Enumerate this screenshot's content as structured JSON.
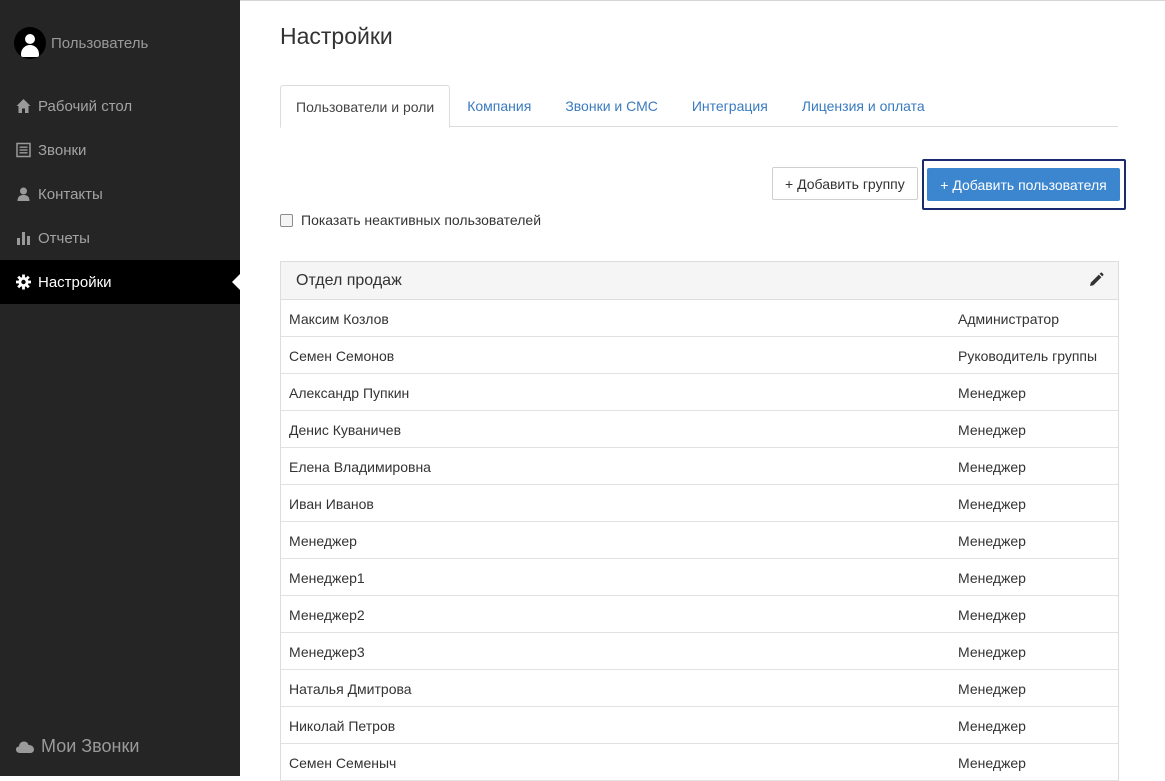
{
  "sidebar": {
    "user_label": "Пользователь",
    "items": [
      {
        "label": "Рабочий стол",
        "icon": "home-icon",
        "active": false
      },
      {
        "label": "Звонки",
        "icon": "list-icon",
        "active": false
      },
      {
        "label": "Контакты",
        "icon": "person-icon",
        "active": false
      },
      {
        "label": "Отчеты",
        "icon": "bar-chart-icon",
        "active": false
      },
      {
        "label": "Настройки",
        "icon": "gear-icon",
        "active": true
      }
    ],
    "brand": "Мои Звонки"
  },
  "main": {
    "title": "Настройки",
    "tabs": [
      {
        "label": "Пользователи и роли",
        "active": true
      },
      {
        "label": "Компания",
        "active": false
      },
      {
        "label": "Звонки и СМС",
        "active": false
      },
      {
        "label": "Интеграция",
        "active": false
      },
      {
        "label": "Лицензия и оплата",
        "active": false
      }
    ],
    "add_group_label": "+ Добавить группу",
    "add_user_label": "+ Добавить пользователя",
    "show_inactive_label": "Показать неактивных пользователей",
    "show_inactive_checked": false,
    "group": {
      "name": "Отдел продаж",
      "users": [
        {
          "name": "Максим Козлов",
          "role": "Администратор"
        },
        {
          "name": "Семен Семонов",
          "role": "Руководитель группы"
        },
        {
          "name": "Александр Пупкин",
          "role": "Менеджер"
        },
        {
          "name": "Денис Куваничев",
          "role": "Менеджер"
        },
        {
          "name": "Елена Владимировна",
          "role": "Менеджер"
        },
        {
          "name": "Иван Иванов",
          "role": "Менеджер"
        },
        {
          "name": "Менеджер",
          "role": "Менеджер"
        },
        {
          "name": "Менеджер1",
          "role": "Менеджер"
        },
        {
          "name": "Менеджер2",
          "role": "Менеджер"
        },
        {
          "name": "Менеджер3",
          "role": "Менеджер"
        },
        {
          "name": "Наталья Дмитрова",
          "role": "Менеджер"
        },
        {
          "name": "Николай Петров",
          "role": "Менеджер"
        },
        {
          "name": "Семен Семеныч",
          "role": "Менеджер"
        }
      ]
    }
  },
  "colors": {
    "sidebar_bg": "#252525",
    "accent": "#3b86cf",
    "link": "#3a7bbf"
  }
}
